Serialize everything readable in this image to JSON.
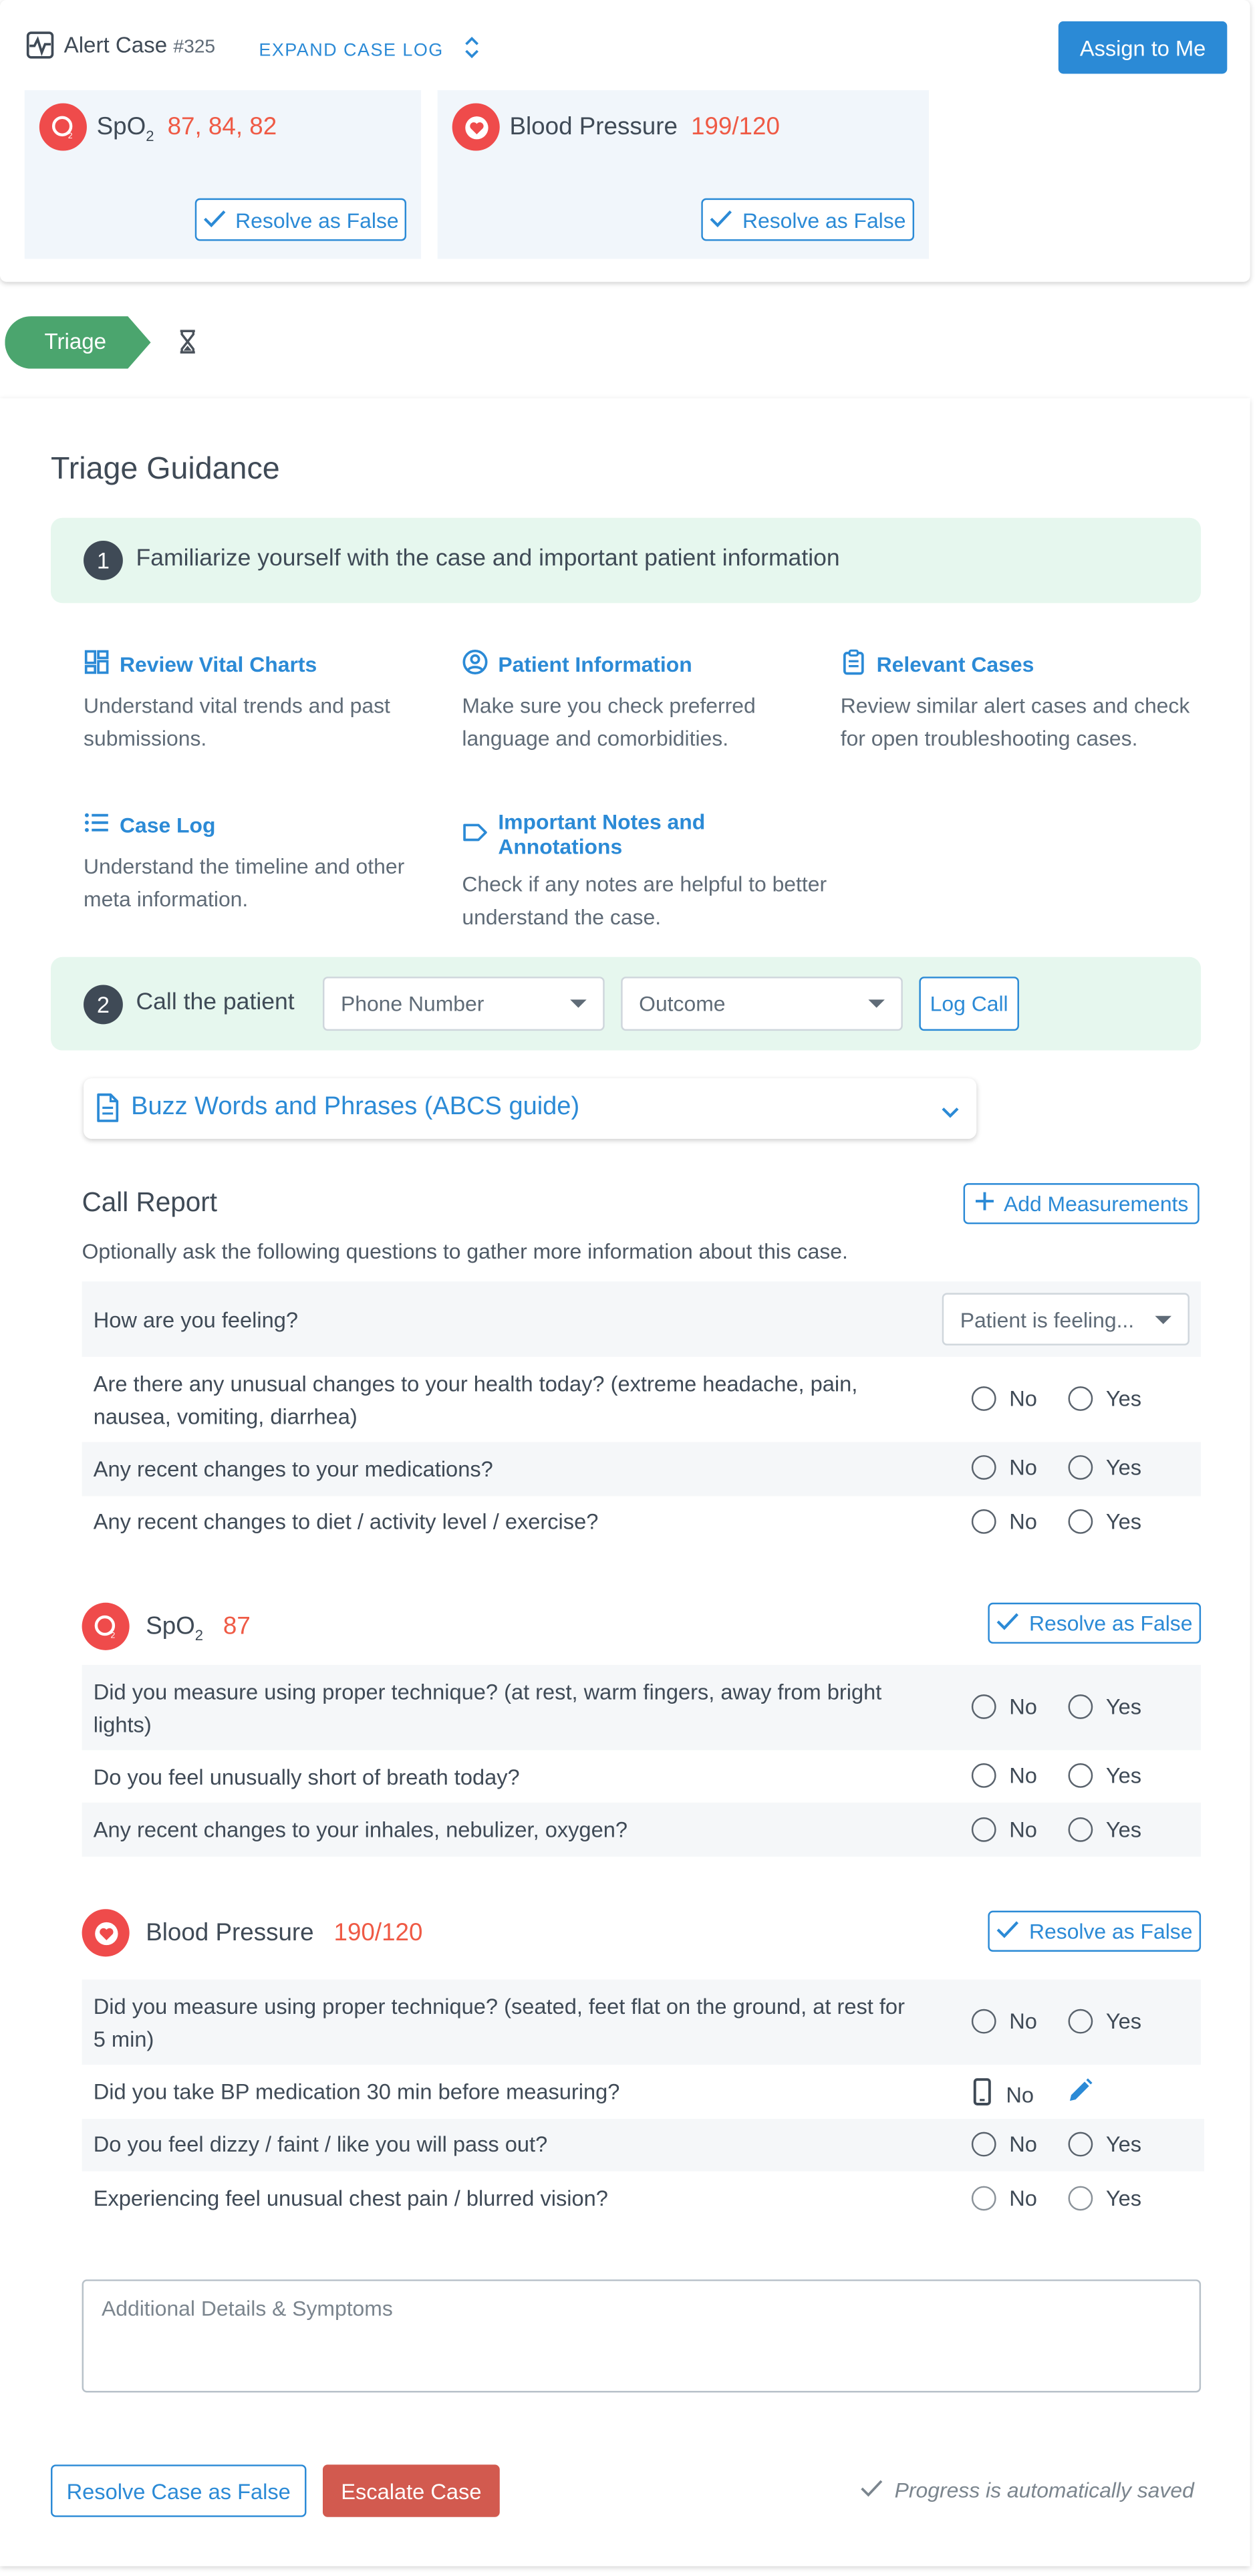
{
  "header": {
    "case_label": "Alert Case",
    "case_number": "#325",
    "expand_label": "EXPAND CASE LOG",
    "assign_label": "Assign to Me"
  },
  "alerts": [
    {
      "name": "SpO",
      "sub": "2",
      "values": "87, 84, 82",
      "resolve_label": "Resolve as False",
      "icon": "o2-icon"
    },
    {
      "name": "Blood Pressure",
      "values": "199/120",
      "resolve_label": "Resolve as False",
      "icon": "heart-icon"
    }
  ],
  "stage": {
    "label": "Triage",
    "next_icon": "hourglass-icon"
  },
  "guidance": {
    "title": "Triage Guidance",
    "step1": {
      "number": "1",
      "text": "Familiarize yourself with the case and important patient information"
    },
    "items": [
      {
        "title": "Review Vital Charts",
        "desc": "Understand vital trends and past submissions.",
        "icon": "dashboard-icon"
      },
      {
        "title": "Patient Information",
        "desc": "Make sure you check preferred language and comorbidities.",
        "icon": "user-circle-icon"
      },
      {
        "title": "Relevant Cases",
        "desc": "Review similar alert cases and check for open troubleshooting cases.",
        "icon": "clipboard-icon"
      },
      {
        "title": "Case Log",
        "desc": "Understand the timeline and other meta information.",
        "icon": "list-icon"
      },
      {
        "title": "Important Notes and Annotations",
        "desc": "Check if any notes are helpful to better understand the case.",
        "icon": "label-icon"
      }
    ],
    "step2": {
      "number": "2",
      "text": "Call the patient",
      "phone_placeholder": "Phone Number",
      "outcome_placeholder": "Outcome",
      "log_label": "Log Call"
    },
    "buzz": {
      "title": "Buzz Words and Phrases (ABCS guide)"
    }
  },
  "report": {
    "title": "Call Report",
    "add_label": "Add Measurements",
    "subtitle": "Optionally ask the following questions to gather more information about this case.",
    "feeling_q": "How are you feeling?",
    "feeling_placeholder": "Patient is feeling...",
    "no": "No",
    "yes": "Yes",
    "general": [
      "Are there any unusual changes to your health today? (extreme headache, pain, nausea, vomiting, diarrhea)",
      "Any recent changes to your medications?",
      "Any recent changes to diet / activity level / exercise?"
    ],
    "spo2": {
      "name": "SpO",
      "sub": "2",
      "value": "87",
      "resolve_label": "Resolve as False",
      "questions": [
        "Did you measure using proper technique? (at rest, warm fingers, away from bright lights)",
        "Do you feel unusually short of breath today?",
        "Any recent changes to your inhales, nebulizer, oxygen?"
      ]
    },
    "bp": {
      "name": "Blood Pressure",
      "value": "190/120",
      "resolve_label": "Resolve as False",
      "questions": [
        "Did you measure using proper technique? (seated, feet flat on the ground, at rest for 5 min)",
        "Did you take BP medication 30 min before measuring?",
        "Do you feel dizzy / faint / like you will pass out?",
        "Experiencing feel unusual chest pain / blurred vision?"
      ]
    },
    "details_placeholder": "Additional Details & Symptoms"
  },
  "footer": {
    "resolve_label": "Resolve Case as False",
    "escalate_label": "Escalate Case",
    "saved_text": "Progress is automatically saved"
  },
  "colors": {
    "accent": "#2b8ad6",
    "alert": "#ef5a45",
    "triage": "#4ba56e",
    "step_bg": "#e6f7ee",
    "danger": "#d25a4f"
  }
}
